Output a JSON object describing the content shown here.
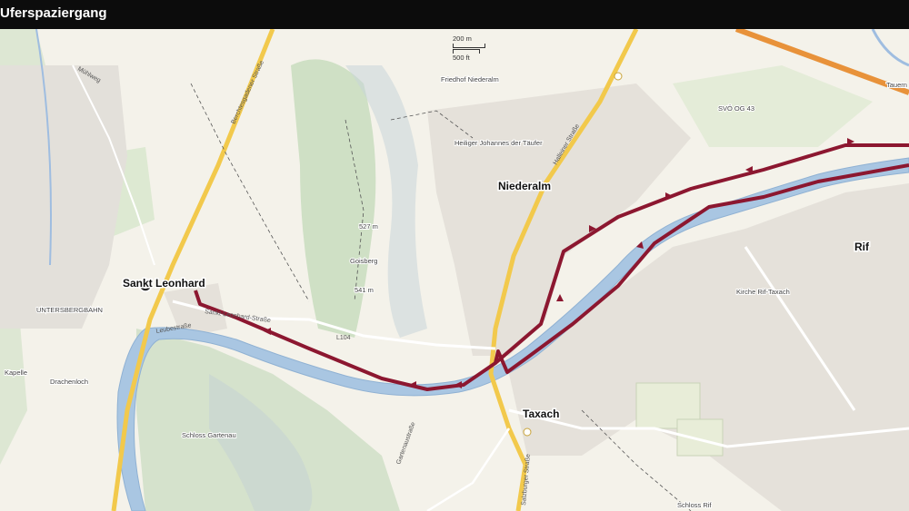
{
  "header": {
    "title": "Uferspaziergang"
  },
  "scale": {
    "metric": "200 m",
    "imperial": "500 ft"
  },
  "route_color": "#8c1730",
  "places": {
    "sankt_leonhard": "Sankt Leonhard",
    "niederalm": "Niederalm",
    "taxach": "Taxach",
    "rif": "Rif"
  },
  "labels": {
    "friedhof": "Friedhof Niederalm",
    "kirche_jt": "Heiliger Johannes der Täufer",
    "kirche_rif": "Kirche Rif-Taxach",
    "schloss_gartenau": "Schloss Gartenau",
    "schloss_rif": "Schloss Rif",
    "goisberg": "Goisberg",
    "peak1": "527 m",
    "peak2": "541 m",
    "untersberg": "UNTERSBERGBAHN",
    "kapelle": "Kapelle",
    "drachenloch": "Drachenloch",
    "svo": "SVÖ OG 43",
    "tauern": "Tauern"
  },
  "roads": {
    "l104": "L104",
    "st_leonhard_str": "Sankt-Leonhard-Straße",
    "leube": "Leubestraße",
    "berchtesgadener": "Berchtesgadener Straße",
    "salzburger": "Salzburger Straße",
    "gartenau_str": "Gartenaustraße",
    "hallein_str": "Halleiner Straße",
    "muehlweg": "Mühlweg"
  }
}
